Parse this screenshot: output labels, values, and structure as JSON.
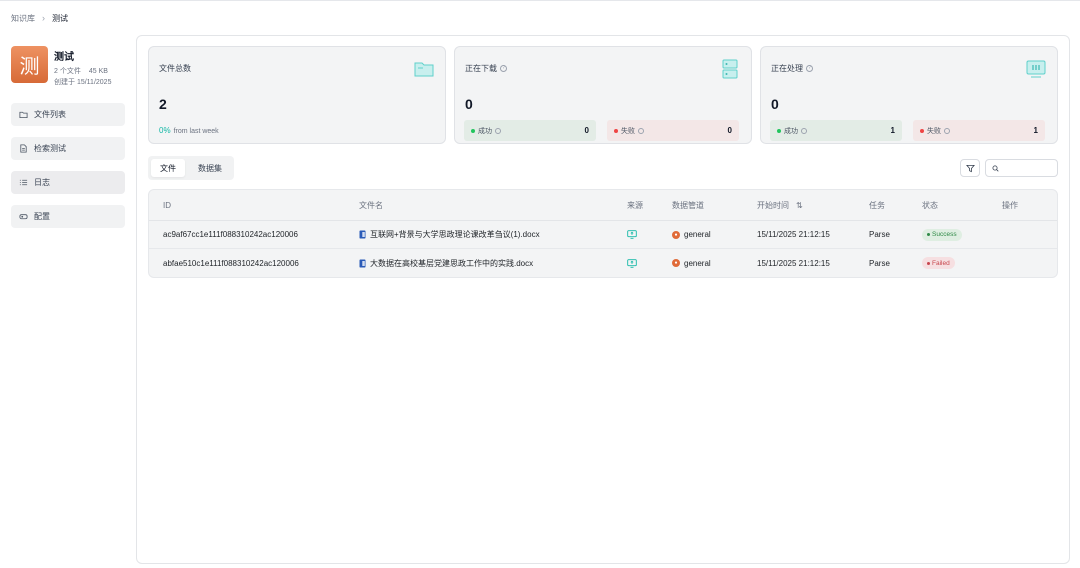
{
  "breadcrumb": {
    "root": "知识库",
    "current": "测试"
  },
  "kb": {
    "avatar_char": "测",
    "name": "测试",
    "file_count": "2 个文件",
    "size": "45 KB",
    "created": "创建于 15/11/2025"
  },
  "sidebar": {
    "items": [
      {
        "label": "文件列表",
        "icon": "folder-icon"
      },
      {
        "label": "检索测试",
        "icon": "document-search-icon"
      },
      {
        "label": "日志",
        "icon": "list-icon",
        "active": true
      },
      {
        "label": "配置",
        "icon": "settings-icon"
      }
    ]
  },
  "stats": {
    "total": {
      "title": "文件总数",
      "value": "2",
      "trend_pct": "0%",
      "trend_text": "from last week"
    },
    "downloading": {
      "title": "正在下载",
      "value": "0",
      "ok_label": "成功",
      "ok_count": "0",
      "fail_label": "失败",
      "fail_count": "0"
    },
    "processing": {
      "title": "正在处理",
      "value": "0",
      "ok_label": "成功",
      "ok_count": "1",
      "fail_label": "失败",
      "fail_count": "1"
    }
  },
  "tabs": [
    {
      "label": "文件",
      "active": true
    },
    {
      "label": "数据集"
    }
  ],
  "search": {
    "placeholder": ""
  },
  "table": {
    "headers": {
      "id": "ID",
      "name": "文件名",
      "source": "来源",
      "pipeline": "数据管道",
      "start_time": "开始时间",
      "task": "任务",
      "status": "状态",
      "action": "操作"
    },
    "rows": [
      {
        "id": "ac9af67cc1e111f088310242ac120006",
        "name": "互联网+背景与大学思政理论课改革刍议(1).docx",
        "pipeline": "general",
        "start_time": "15/11/2025 21:12:15",
        "task": "Parse",
        "status": "Success"
      },
      {
        "id": "abfae510c1e111f088310242ac120006",
        "name": "大数据在高校基层党建思政工作中的实践.docx",
        "pipeline": "general",
        "start_time": "15/11/2025 21:12:15",
        "task": "Parse",
        "status": "Failed"
      }
    ]
  },
  "colors": {
    "accent": "#14b8a6",
    "success": "#2f8a47",
    "failed": "#c7464d",
    "avatar": "#e07b48"
  }
}
